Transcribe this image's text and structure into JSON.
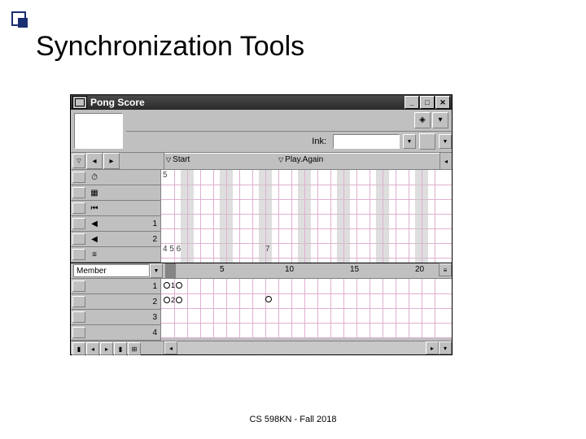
{
  "slide": {
    "title": "Synchronization Tools",
    "footer": "CS 598KN - Fall 2018"
  },
  "window": {
    "title": "Pong Score",
    "ink_label": "Ink:",
    "markers": [
      {
        "label": "Start",
        "frame": 1
      },
      {
        "label": "Play.Again",
        "frame": 8
      }
    ],
    "effect_channels": [
      {
        "icon": "⏱",
        "num": ""
      },
      {
        "icon": "▦",
        "num": ""
      },
      {
        "icon": "⏮",
        "num": ""
      },
      {
        "icon": "🔈",
        "num": "1"
      },
      {
        "icon": "🔈",
        "num": "2"
      },
      {
        "icon": "≡",
        "num": ""
      }
    ],
    "effect_notes": {
      "5": "5",
      "456": "4 5 6",
      "7": "7"
    },
    "member_label": "Member",
    "ruler": [
      "5",
      "10",
      "15",
      "20"
    ],
    "sprite_channels": [
      "1",
      "2",
      "3",
      "4"
    ],
    "sprite_cells": [
      {
        "row": 0,
        "text": "1"
      },
      {
        "row": 1,
        "text": "2"
      }
    ]
  }
}
